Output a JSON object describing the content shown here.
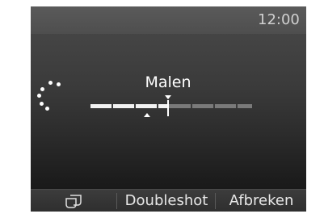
{
  "status": {
    "time": "12:00"
  },
  "main": {
    "title": "Malen",
    "progress_fraction": 0.48
  },
  "footer": {
    "cups_icon": "two-cups-icon",
    "doubleshot_label": "Doubleshot",
    "abort_label": "Afbreken"
  },
  "colors": {
    "active_track": "#f2f2f2",
    "inactive_track": "#7a7a7a",
    "text": "#ffffff"
  }
}
